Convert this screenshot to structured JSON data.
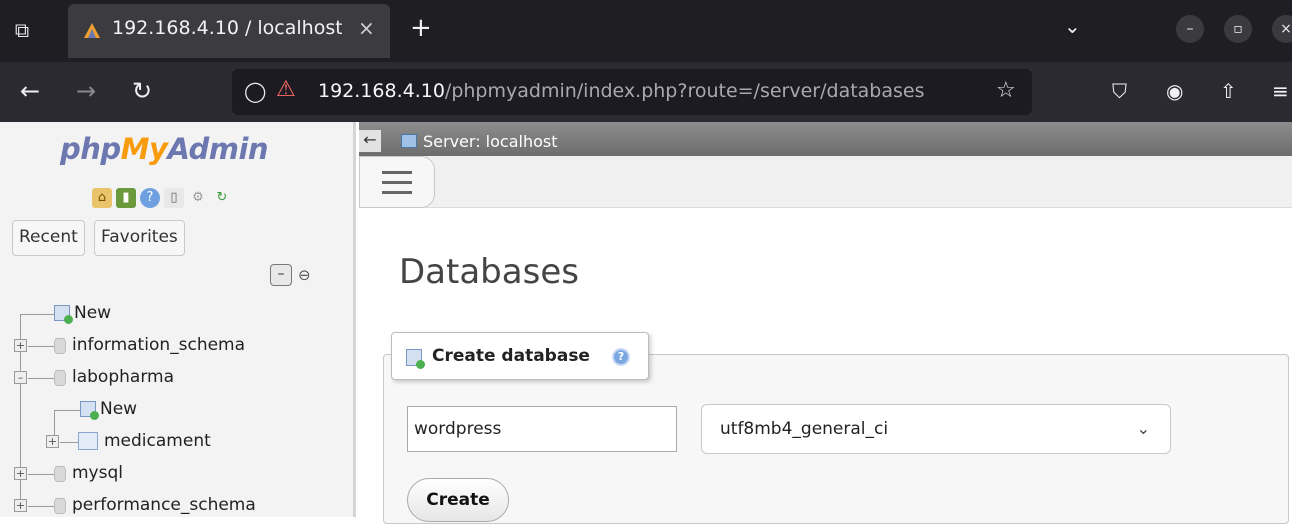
{
  "browser": {
    "tab_title": "192.168.4.10 / localhost | ",
    "tab_close": "×",
    "new_tab": "+",
    "url_host": "192.168.4.10",
    "url_path": "/phpmyadmin/index.php?route=/server/databases"
  },
  "sidebar": {
    "logo_php": "php",
    "logo_my": "My",
    "logo_admin": "Admin",
    "tab_recent": "Recent",
    "tab_favorites": "Favorites",
    "tree": {
      "new": "New",
      "db1": "information_schema",
      "db2": "labopharma",
      "db2_new": "New",
      "db2_table": "medicament",
      "db3": "mysql",
      "db4": "performance_schema"
    }
  },
  "main": {
    "server_title": "Server: localhost",
    "page_title": "Databases",
    "create_legend": "Create database",
    "db_name_value": "wordpress",
    "collation_value": "utf8mb4_general_ci",
    "create_button": "Create"
  },
  "colors": {
    "logo_blue": "#6c78af",
    "logo_orange": "#f89c0e",
    "chrome_dark": "#1f1f23"
  }
}
